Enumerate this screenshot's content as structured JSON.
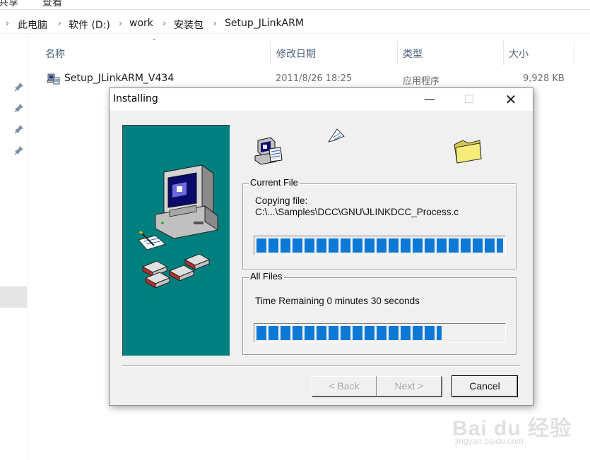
{
  "menu": {
    "item_share": "共享",
    "item_view": "查看"
  },
  "address_bar": {
    "crumbs": [
      "此电脑",
      "软件 (D:)",
      "work",
      "安装包",
      "Setup_JLinkARM"
    ]
  },
  "columns": {
    "name": "名称",
    "modified": "修改日期",
    "type": "类型",
    "size": "大小"
  },
  "file": {
    "name": "Setup_JLinkARM_V434",
    "modified": "2011/8/26 18:25",
    "type": "应用程序",
    "size": "9,928 KB"
  },
  "dialog": {
    "title": "Installing",
    "current_file": {
      "legend": "Current File",
      "line1": "Copying file:",
      "line2": "C:\\...\\Samples\\DCC\\GNU\\JLINKDCC_Process.c",
      "progress": 1.0
    },
    "all_files": {
      "legend": "All Files",
      "time_remaining": "Time Remaining 0 minutes 30 seconds",
      "progress": 0.75
    },
    "buttons": {
      "back": "< Back",
      "next": "Next >",
      "cancel": "Cancel"
    }
  },
  "watermark": {
    "brand": "Bai du 经验",
    "url": "jingyan.baidu.com"
  },
  "colors": {
    "banner": "#007f7f",
    "progress": "#0c79d6",
    "dialog_bg": "#f0f0f0"
  },
  "icons": [
    "pin-icon",
    "installer-icon",
    "computer-icon",
    "folder-icon",
    "flying-paper-icon",
    "disk-icon"
  ]
}
